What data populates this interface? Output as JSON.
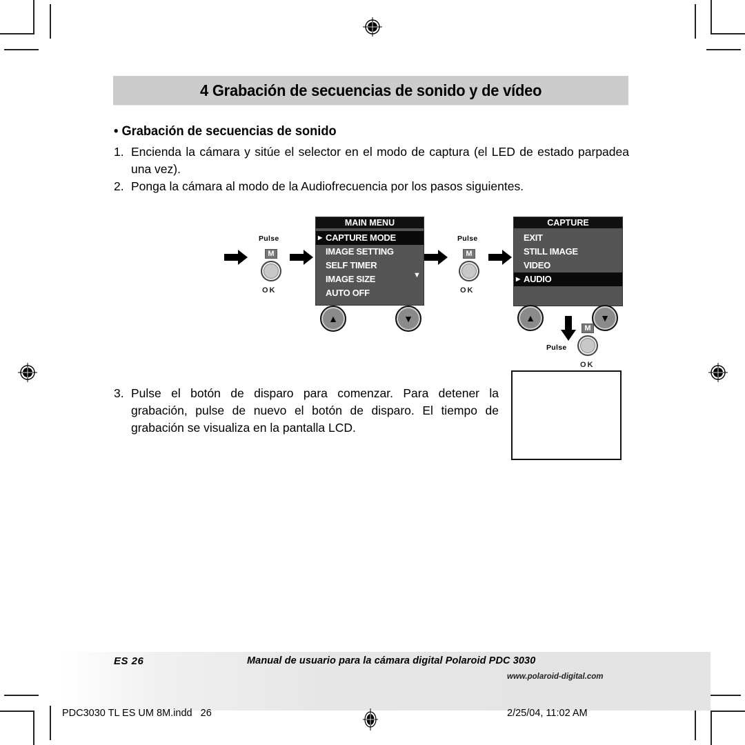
{
  "header": {
    "title": "4 Grabación de secuencias de sonido y de vídeo"
  },
  "section": {
    "subheading": "• Grabación de secuencias de sonido",
    "steps": [
      {
        "number": "1.",
        "text": "Encienda la cámara y sitúe el selector en el modo de captura (el LED de estado parpadea una vez)."
      },
      {
        "number": "2.",
        "text": "Ponga la cámara al modo de la Audiofrecuencia por los pasos siguientes."
      },
      {
        "number": "3.",
        "text": "Pulse el botón de disparo para comenzar. Para detener la grabación, pulse de nuevo el botón de disparo. El tiempo de grabación se visualiza en la pantalla LCD."
      }
    ]
  },
  "diagram": {
    "pulse_label": "Pulse",
    "m_label": "M",
    "ok_label": "OK",
    "main_menu": {
      "title": "MAIN MENU",
      "items": [
        "CAPTURE MODE",
        "IMAGE SETTING",
        "SELF TIMER",
        "IMAGE SIZE",
        "AUTO OFF"
      ],
      "selected": "CAPTURE MODE",
      "scroll_indicator": "▼"
    },
    "capture_menu": {
      "title": "CAPTURE",
      "items": [
        "EXIT",
        "STILL IMAGE",
        "VIDEO",
        "AUDIO"
      ],
      "selected": "AUDIO"
    },
    "nav_up_glyph": "▲",
    "nav_down_glyph": "▼",
    "caret_glyph": "▶"
  },
  "footer": {
    "page": "ES 26",
    "manual_title": "Manual de usuario para la cámara digital Polaroid PDC 3030",
    "url": "www.polaroid-digital.com"
  },
  "print_slug": {
    "filename": "PDC3030 TL ES UM 8M.indd   26",
    "timestamp": "2/25/04, 11:02 AM"
  }
}
